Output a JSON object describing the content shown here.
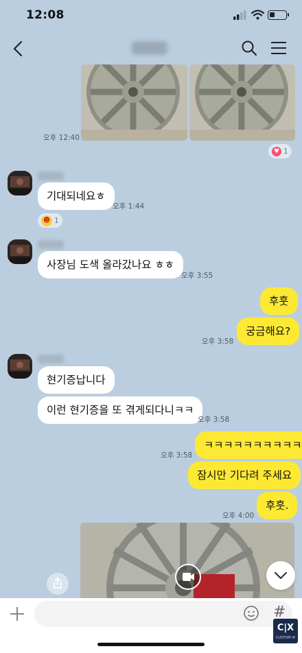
{
  "status_bar": {
    "time": "12:08"
  },
  "messages": {
    "ts_1240": "오후 12:40",
    "reaction_heart_count": "1",
    "m_expect": "기대되네요ㅎ",
    "ts_144": "오후 1:44",
    "reaction_grin_count": "1",
    "m_paint": "사장님 도색 올라갔나요 ㅎㅎ",
    "ts_355": "오후 3:55",
    "m_huhut": "후훗",
    "m_curious": "궁금해요?",
    "ts_358a": "오후 3:58",
    "m_dizzy": "현기증납니다",
    "m_again": "이런 현기증을 또 겪게되다니ㅋㅋ",
    "ts_358b": "오후 3:58",
    "ts_358c": "오후 3:58",
    "m_kkk": "ㅋㅋㅋㅋㅋㅋㅋㅋㅋㅋ",
    "m_wait": "잠시만 기다려 주세요",
    "m_huhut2": "후훗.",
    "ts_400": "오후 4:00"
  },
  "logo": {
    "main": "C|X",
    "sub": "CUSTOM W"
  },
  "colors": {
    "background": "#bacee0",
    "outgoing": "#fde933",
    "incoming": "#ffffff"
  },
  "icons": [
    "back-arrow-icon",
    "search-icon",
    "menu-icon",
    "share-icon",
    "chevron-down-icon",
    "video-icon",
    "plus-icon",
    "emoji-icon",
    "hash-icon"
  ]
}
